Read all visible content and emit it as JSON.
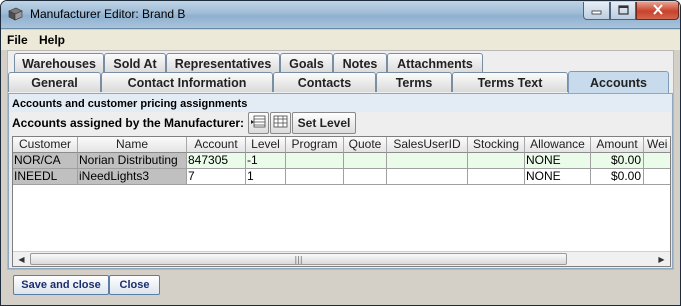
{
  "window": {
    "title": "Manufacturer Editor: Brand B",
    "app_icon": "box-icon",
    "controls": {
      "minimize": "minimize-icon",
      "maximize": "maximize-icon",
      "close": "close-icon"
    }
  },
  "menu": {
    "file": "File",
    "help": "Help"
  },
  "tabs_row1": [
    "Warehouses",
    "Sold At",
    "Representatives",
    "Goals",
    "Notes",
    "Attachments"
  ],
  "tabs_row2": [
    "General",
    "Contact Information",
    "Contacts",
    "Terms",
    "Terms Text",
    "Accounts"
  ],
  "selected_tab": "Accounts",
  "panel": {
    "title": "Accounts and customer pricing assignments",
    "assigned_label": "Accounts assigned by the Manufacturer:",
    "set_level_button": "Set Level"
  },
  "table": {
    "columns": [
      "Customer",
      "Name",
      "Account",
      "Level",
      "Program",
      "Quote",
      "SalesUserID",
      "Stocking",
      "Allowance",
      "Amount",
      "Wei"
    ],
    "rows": [
      [
        "NOR/CA",
        "Norian Distributing",
        "847305",
        "-1",
        "",
        "",
        "",
        "",
        "NONE",
        "$0.00",
        ""
      ],
      [
        "INEEDL",
        "iNeedLights3",
        "7",
        "1",
        "",
        "",
        "",
        "",
        "NONE",
        "$0.00",
        ""
      ]
    ],
    "selected_row": 0
  },
  "buttons": {
    "save_close": "Save and close",
    "close": "Close"
  },
  "colors": {
    "selected_tab": "#c8dbed",
    "row_highlight": "#eafbea",
    "fixed_column": "#c0c0c0"
  }
}
